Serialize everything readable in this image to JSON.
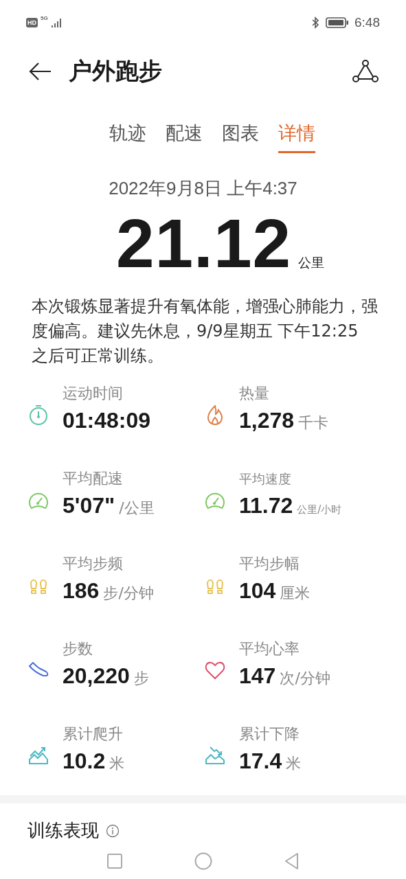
{
  "status_bar": {
    "hd": "HD",
    "network": "5G",
    "time": "6:48"
  },
  "header": {
    "title": "户外跑步"
  },
  "tabs": [
    {
      "label": "轨迹",
      "selected": false
    },
    {
      "label": "配速",
      "selected": false
    },
    {
      "label": "图表",
      "selected": false
    },
    {
      "label": "详情",
      "selected": true
    }
  ],
  "summary": {
    "date": "2022年9月8日 上午4:37",
    "distance": "21.12",
    "distance_unit": "公里",
    "advice": "本次锻炼显著提升有氧体能，增强心肺能力，强度偏高。建议先休息，9/9星期五 下午12:25 之后可正常训练。"
  },
  "stats": [
    {
      "kind": "timer",
      "color": "#5cc2a4",
      "label": "运动时间",
      "value": "01:48:09",
      "compact": false
    },
    {
      "kind": "flame",
      "color": "#e0804a",
      "label": "热量",
      "value": "1,278",
      "unit": "千卡",
      "compact": false
    },
    {
      "kind": "gauge",
      "color": "#7ec860",
      "label": "平均配速",
      "value": "5'07\"",
      "unit": "/公里",
      "compact": false
    },
    {
      "kind": "gauge",
      "color": "#7ec860",
      "label": "平均速度",
      "value": "11.72",
      "unit": "公里/小时",
      "compact": true
    },
    {
      "kind": "footprints",
      "color": "#e8c45a",
      "label": "平均步频",
      "value": "186",
      "unit": "步/分钟",
      "compact": false
    },
    {
      "kind": "footprints",
      "color": "#e8c45a",
      "label": "平均步幅",
      "value": "104",
      "unit": "厘米",
      "compact": false
    },
    {
      "kind": "shoe",
      "color": "#4a6fd8",
      "label": "步数",
      "value": "20,220",
      "unit": "步",
      "compact": false
    },
    {
      "kind": "heart",
      "color": "#e0506a",
      "label": "平均心率",
      "value": "147",
      "unit": "次/分钟",
      "compact": false
    },
    {
      "kind": "climb",
      "color": "#4ab8c0",
      "label": "累计爬升",
      "value": "10.2",
      "unit": "米",
      "compact": false
    },
    {
      "kind": "descend",
      "color": "#4ab8c0",
      "label": "累计下降",
      "value": "17.4",
      "unit": "米",
      "compact": false
    }
  ],
  "section": {
    "title": "训练表现"
  }
}
